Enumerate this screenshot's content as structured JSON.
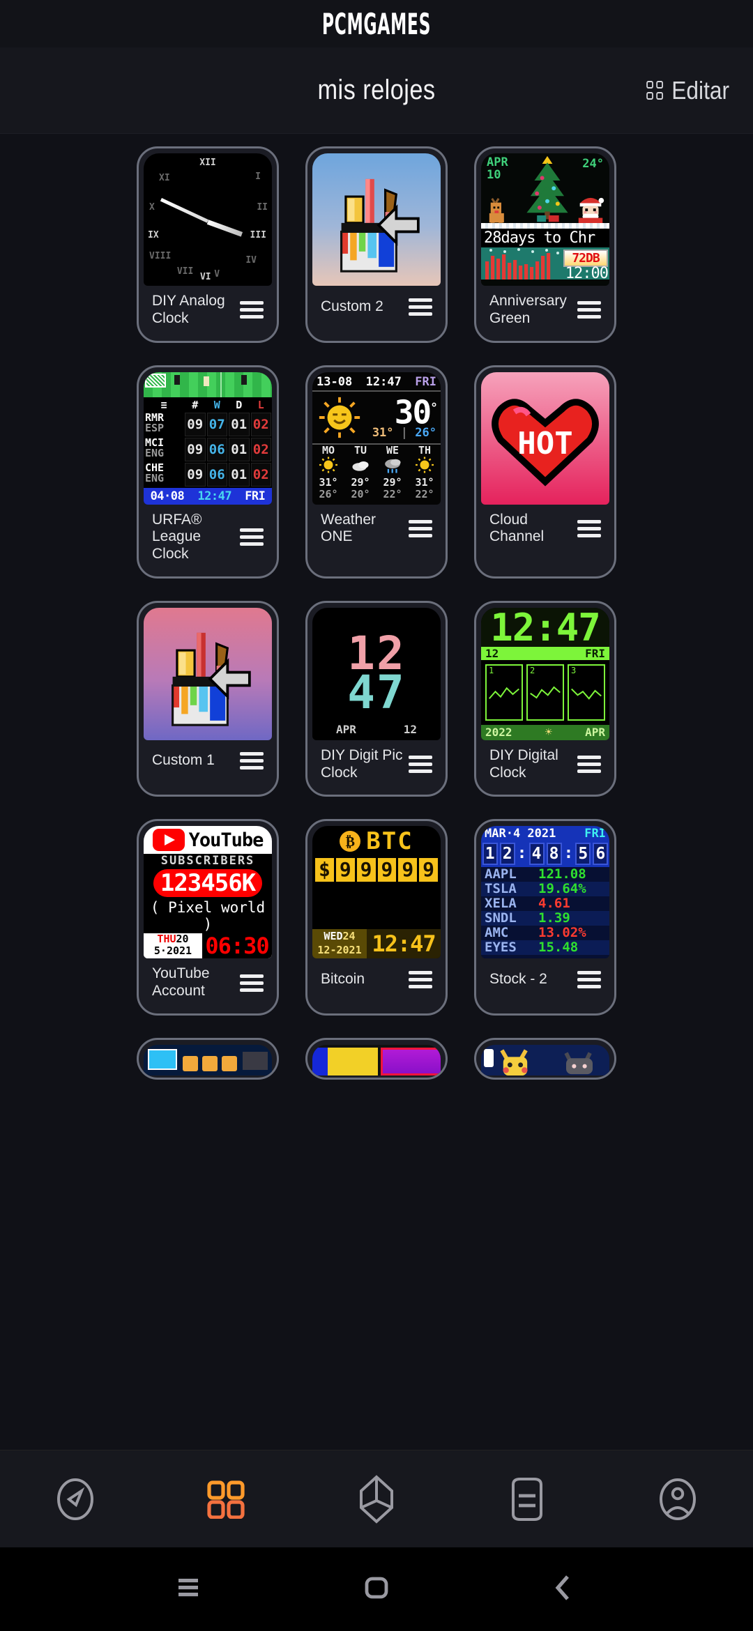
{
  "header": {
    "brand": "PCMGAMES",
    "page_title": "mis relojes",
    "edit_label": "Editar"
  },
  "watch_faces": [
    {
      "id": "diy-analog-clock",
      "name": "DIY Analog Clock",
      "numerals": [
        "XII",
        "I",
        "II",
        "III",
        "IV",
        "V",
        "VI",
        "VII",
        "VIII",
        "IX",
        "X",
        "XI"
      ]
    },
    {
      "id": "custom-2",
      "name": "Custom 2"
    },
    {
      "id": "anniversary-green",
      "name": "Anniversary Green",
      "month": "APR",
      "day": "10",
      "temp": "24°",
      "countdown": "28days to Chr",
      "db_value": "72DB",
      "time": "12:00"
    },
    {
      "id": "urfa-league-clock",
      "name": "URFA® League Clock",
      "columns": [
        "≡",
        "#",
        "W",
        "D",
        "L"
      ],
      "rows": [
        {
          "team": "RMR",
          "country": "ESP",
          "played": "09",
          "w": "07",
          "d": "01",
          "l": "02"
        },
        {
          "team": "MCI",
          "country": "ENG",
          "played": "09",
          "w": "06",
          "d": "01",
          "l": "02"
        },
        {
          "team": "CHE",
          "country": "ENG",
          "played": "09",
          "w": "06",
          "d": "01",
          "l": "02"
        }
      ],
      "date": "04·08",
      "time": "12:47",
      "weekday": "FRI"
    },
    {
      "id": "weather-one",
      "name": "Weather ONE",
      "date": "13-08",
      "time": "12:47",
      "weekday": "FRI",
      "temp": "30",
      "high": "31°",
      "low": "26°",
      "forecast": [
        {
          "day": "MO",
          "icon": "sun",
          "hi": "31°",
          "lo": "26°"
        },
        {
          "day": "TU",
          "icon": "cloud",
          "hi": "29°",
          "lo": "20°"
        },
        {
          "day": "WE",
          "icon": "rain",
          "hi": "29°",
          "lo": "22°"
        },
        {
          "day": "TH",
          "icon": "sun",
          "hi": "31°",
          "lo": "22°"
        }
      ]
    },
    {
      "id": "cloud-channel",
      "name": "Cloud Channel",
      "heart_text": "HOT"
    },
    {
      "id": "custom-1",
      "name": "Custom 1"
    },
    {
      "id": "diy-digit-pic-clock",
      "name": "DIY Digit Pic Clock",
      "hour": "12",
      "minute": "47",
      "month": "APR",
      "day": "12"
    },
    {
      "id": "diy-digital-clock",
      "name": "DIY Digital Clock",
      "time": "12:47",
      "date_num": "12",
      "weekday": "FRI",
      "boxes": [
        "1",
        "2",
        "3"
      ],
      "year": "2022",
      "month": "APR"
    },
    {
      "id": "youtube-account",
      "name": "YouTube Account",
      "brand": "YouTube",
      "subs_label": "SUBSCRIBERS",
      "count": "123456K",
      "channel": "( Pixel world )",
      "weekday": "THU",
      "date_day": "20",
      "date_rest": "5·2021",
      "time": "06:30"
    },
    {
      "id": "bitcoin",
      "name": "Bitcoin",
      "symbol": "₿",
      "title": "BTC",
      "price": [
        "$",
        "9",
        "9",
        "9",
        "9",
        "9"
      ],
      "weekday": "WED",
      "date_day": "24",
      "date_rest": "12-2021",
      "time": "12:47"
    },
    {
      "id": "stock-2",
      "name": "Stock - 2",
      "date": "MAR·4 2021",
      "weekday": "FRI",
      "clock": [
        "1",
        "2",
        ":",
        "4",
        "8",
        ":",
        "5",
        "6"
      ],
      "rows": [
        {
          "symbol": "AAPL",
          "value": "121.08",
          "dir": "up"
        },
        {
          "symbol": "TSLA",
          "value": "19.64%",
          "dir": "up"
        },
        {
          "symbol": "XELA",
          "value": "4.61",
          "dir": "down"
        },
        {
          "symbol": "SNDL",
          "value": "1.39",
          "dir": "up"
        },
        {
          "symbol": "AMC",
          "value": "13.02%",
          "dir": "down"
        },
        {
          "symbol": "EYES",
          "value": "15.48",
          "dir": "up"
        }
      ]
    }
  ],
  "bottom_nav": {
    "items": [
      {
        "id": "discover",
        "icon": "compass-icon",
        "active": false
      },
      {
        "id": "my-watch-faces",
        "icon": "grid-icon",
        "active": true
      },
      {
        "id": "create",
        "icon": "cube-icon",
        "active": false
      },
      {
        "id": "feed",
        "icon": "list-icon",
        "active": false
      },
      {
        "id": "profile",
        "icon": "person-icon",
        "active": false
      }
    ],
    "accent": "#ff9a2b"
  },
  "system_nav": {
    "items": [
      {
        "id": "recents",
        "icon": "menu-icon"
      },
      {
        "id": "home",
        "icon": "home-icon"
      },
      {
        "id": "back",
        "icon": "back-icon"
      }
    ]
  }
}
